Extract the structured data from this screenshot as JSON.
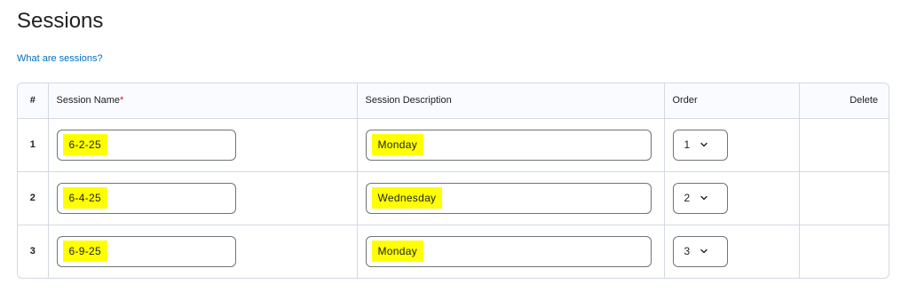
{
  "page": {
    "title": "Sessions",
    "help_link": "What are sessions?"
  },
  "table": {
    "headers": {
      "number": "#",
      "session_name": "Session Name",
      "required_marker": "*",
      "session_description": "Session Description",
      "order": "Order",
      "delete": "Delete"
    },
    "rows": [
      {
        "number": "1",
        "name": "6-2-25",
        "description": "Monday",
        "order": "1"
      },
      {
        "number": "2",
        "name": "6-4-25",
        "description": "Wednesday",
        "order": "2"
      },
      {
        "number": "3",
        "name": "6-9-25",
        "description": "Monday",
        "order": "3"
      }
    ]
  },
  "icons": {
    "delete": "trash-icon",
    "select": "chevron-down-icon"
  },
  "colors": {
    "link": "#006fbf",
    "highlight": "#ffff00",
    "required": "#cd2026"
  }
}
